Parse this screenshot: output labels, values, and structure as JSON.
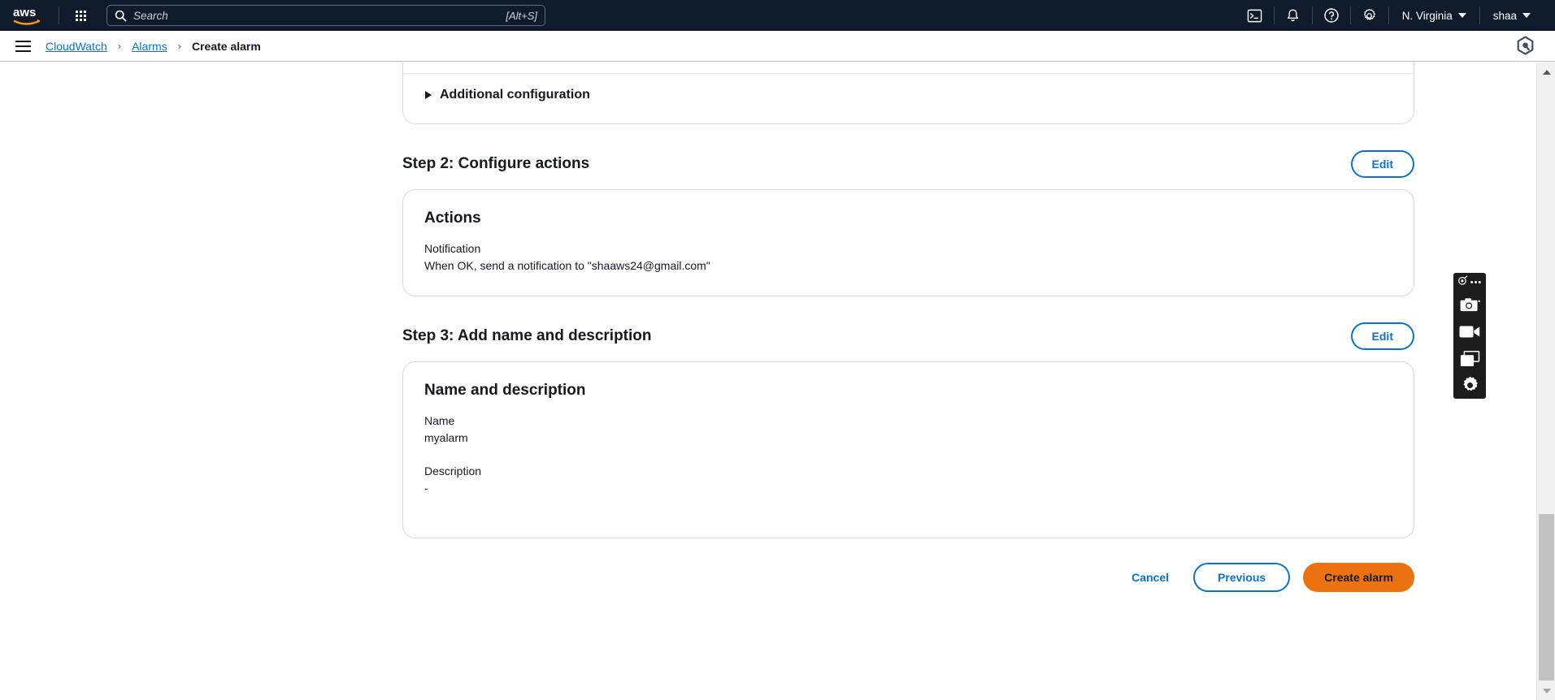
{
  "topnav": {
    "logo_alt": "aws",
    "apps_label": "Applications menu",
    "search": {
      "placeholder": "Search",
      "value": "",
      "shortcut": "[Alt+S]",
      "icon": "search-icon"
    },
    "icons": [
      {
        "name": "cloudshell-icon",
        "label": "CloudShell"
      },
      {
        "name": "bell-icon",
        "label": "Notifications"
      },
      {
        "name": "help-circle-icon",
        "label": "Help"
      },
      {
        "name": "gear-icon",
        "label": "Settings"
      }
    ],
    "region": {
      "label": "N. Virginia",
      "caret": "caret-down-icon"
    },
    "account": {
      "label": "shaa",
      "caret": "caret-down-icon"
    }
  },
  "breadcrumb": {
    "menu_icon": "hamburger-icon",
    "items": [
      {
        "label": "CloudWatch",
        "link": true
      },
      {
        "label": "Alarms",
        "link": true
      },
      {
        "label": "Create alarm",
        "link": false
      }
    ],
    "separator": "›",
    "assistant_icon": "amazon-q-hexagon-icon"
  },
  "content": {
    "additional_configuration": {
      "label": "Additional configuration",
      "expanded": false,
      "icon": "triangle-right-icon"
    },
    "steps": [
      {
        "heading": "Step 2: Configure actions",
        "edit_label": "Edit",
        "card_title": "Actions",
        "fields": [
          {
            "label": "Notification",
            "value": "When OK, send a notification to \"shaaws24@gmail.com\""
          }
        ]
      },
      {
        "heading": "Step 3: Add name and description",
        "edit_label": "Edit",
        "card_title": "Name and description",
        "fields": [
          {
            "label": "Name",
            "value": "myalarm"
          },
          {
            "label": "Description",
            "value": "-"
          }
        ]
      }
    ],
    "footer": {
      "cancel_label": "Cancel",
      "previous_label": "Previous",
      "create_label": "Create alarm",
      "accent_color": "#ec7211",
      "link_color": "#0972d3"
    }
  },
  "recorder_toolbar": {
    "menu_label": "•••",
    "buttons": [
      {
        "name": "screenshot-camera-icon",
        "label": "Screenshot"
      },
      {
        "name": "video-record-icon",
        "label": "Record video"
      },
      {
        "name": "window-capture-icon",
        "label": "Capture window"
      },
      {
        "name": "recorder-settings-gear-icon",
        "label": "Settings"
      }
    ]
  },
  "scrollbar": {
    "up_icon": "scroll-up-arrow-icon",
    "down_icon": "scroll-down-arrow-icon"
  }
}
